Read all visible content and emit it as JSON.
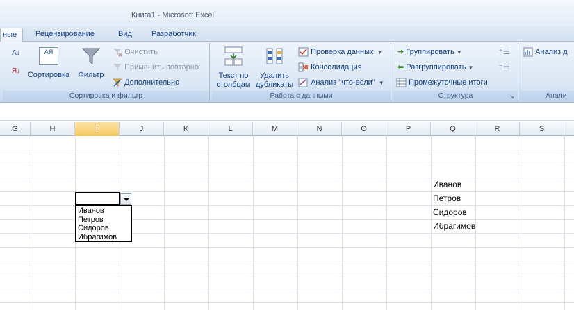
{
  "window": {
    "title": "Книга1 - Microsoft Excel"
  },
  "tabs": [
    {
      "label": "ные",
      "active": true
    },
    {
      "label": "Рецензирование",
      "active": false
    },
    {
      "label": "Вид",
      "active": false
    },
    {
      "label": "Разработчик",
      "active": false
    }
  ],
  "ribbon": {
    "sort_filter": {
      "group_label": "Сортировка и фильтр",
      "sort_label": "Сортировка",
      "filter_label": "Фильтр",
      "clear_label": "Очистить",
      "reapply_label": "Применить повторно",
      "advanced_label": "Дополнительно",
      "sort_az_icon": "А↓",
      "sort_za_icon": "Я↓",
      "sort_dialog_icon": "АЯ"
    },
    "data_tools": {
      "group_label": "Работа с данными",
      "text_to_columns_line1": "Текст по",
      "text_to_columns_line2": "столбцам",
      "remove_duplicates_line1": "Удалить",
      "remove_duplicates_line2": "дубликаты",
      "validation_label": "Проверка данных",
      "consolidate_label": "Консолидация",
      "whatif_label": "Анализ \"что-если\""
    },
    "outline": {
      "group_label": "Структура",
      "group_label_btn": "Группировать",
      "ungroup_label": "Разгруппировать",
      "subtotal_label": "Промежуточные итоги"
    },
    "analysis": {
      "group_label": "Анали",
      "data_analysis_label": "Анализ д"
    }
  },
  "columns": [
    "G",
    "H",
    "I",
    "J",
    "K",
    "L",
    "M",
    "N",
    "O",
    "P",
    "Q",
    "R",
    "S"
  ],
  "selected_column": "I",
  "cells": {
    "q5": "Иванов",
    "q6": "Петров",
    "q7": "Сидоров",
    "q8": "Ибрагимов"
  },
  "dropdown": {
    "options": [
      "Иванов",
      "Петров",
      "Сидоров",
      "Ибрагимов"
    ]
  }
}
